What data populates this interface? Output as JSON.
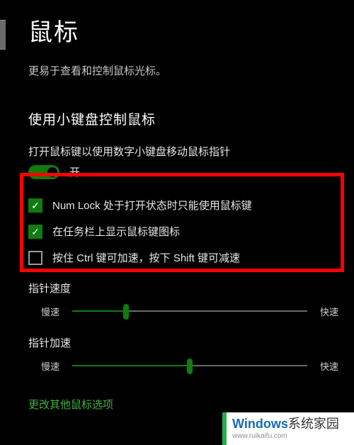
{
  "page": {
    "title": "鼠标",
    "subtitle": "更易于查看和控制鼠标光标。"
  },
  "section": {
    "heading": "使用小键盘控制鼠标",
    "toggle_label": "打开鼠标键以使用数字小键盘移动鼠标指针",
    "toggle_state": "开"
  },
  "checkboxes": {
    "numlock": {
      "label": "Num Lock 处于打开状态时只能使用鼠标键",
      "checked": true
    },
    "taskbar": {
      "label": "在任务栏上显示鼠标键图标",
      "checked": true
    },
    "ctrlshift": {
      "label": "按住 Ctrl 键可加速，按下 Shift 键可减速",
      "checked": false
    }
  },
  "sliders": {
    "speed": {
      "title": "指针速度",
      "min_label": "慢速",
      "max_label": "快速",
      "percent": 23
    },
    "accel": {
      "title": "指针加速",
      "min_label": "慢速",
      "max_label": "快速",
      "percent": 50
    }
  },
  "link": {
    "other_options": "更改其他鼠标选项"
  },
  "watermark": {
    "brand_prefix": "W",
    "brand_win": "indows",
    "brand_suffix": "系统家园",
    "url": "www.ruikaifu.com"
  },
  "colors": {
    "accent": "#107c10",
    "highlight": "#ff0000"
  }
}
